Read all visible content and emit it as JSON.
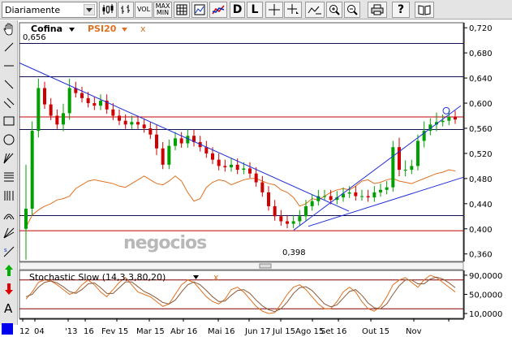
{
  "toolbar": {
    "period_value": "Diariamente",
    "vol_label": "VOL",
    "maxmin_label_1": "MAX",
    "maxmin_label_2": "MIN",
    "d_label": "D",
    "l_label": "L",
    "help_label": "?"
  },
  "legend": {
    "main_name": "Cofina",
    "compare_name": "PSI20",
    "close_mark": "x"
  },
  "watermark": "negocios",
  "annotations": {
    "high": "0,656",
    "low": "0,398"
  },
  "stoch_title": "Stochastic Slow (14,3,3,80,20)",
  "colors": {
    "price_up": "#00a000",
    "price_down": "#d00000",
    "psi20": "#e07020",
    "trend": "#2030d8",
    "stoch": "#e07020",
    "level_red": "#c00000",
    "level_navy": "#101050",
    "stoch_band": "#800000"
  },
  "chart_data": [
    {
      "type": "candlestick",
      "name": "Cofina",
      "yticks": [
        "0,720",
        "0,680",
        "0,640",
        "0,600",
        "0,560",
        "0,520",
        "0,480",
        "0,440",
        "0,400",
        "0,360"
      ],
      "ylim": [
        0.348,
        0.728
      ],
      "xticks": [
        "12",
        "04",
        "'13",
        "16",
        "Fev 15",
        "Mar 15",
        "Abr 16",
        "Mai 16",
        "Jun 17",
        "Jul 15",
        "Ago 15",
        "Set 16",
        "Out 15",
        "Nov"
      ],
      "hlines": [
        {
          "value": 0.695,
          "color": "navy"
        },
        {
          "value": 0.642,
          "color": "navy"
        },
        {
          "value": 0.578,
          "color": "red"
        },
        {
          "value": 0.558,
          "color": "navy"
        },
        {
          "value": 0.421,
          "color": "navy"
        },
        {
          "value": 0.397,
          "color": "red"
        }
      ],
      "close": [
        0.432,
        0.556,
        0.624,
        0.598,
        0.58,
        0.566,
        0.584,
        0.624,
        0.616,
        0.608,
        0.6,
        0.596,
        0.604,
        0.59,
        0.58,
        0.572,
        0.566,
        0.57,
        0.566,
        0.56,
        0.55,
        0.528,
        0.502,
        0.532,
        0.544,
        0.536,
        0.548,
        0.538,
        0.53,
        0.52,
        0.51,
        0.5,
        0.498,
        0.502,
        0.494,
        0.496,
        0.488,
        0.474,
        0.458,
        0.436,
        0.42,
        0.412,
        0.408,
        0.412,
        0.42,
        0.436,
        0.444,
        0.452,
        0.452,
        0.446,
        0.45,
        0.456,
        0.458,
        0.452,
        0.452,
        0.45,
        0.458,
        0.462,
        0.466,
        0.53,
        0.494,
        0.494,
        0.5,
        0.54,
        0.556,
        0.566,
        0.57,
        0.572,
        0.578,
        0.574
      ],
      "high_label": 0.656,
      "low_label": 0.398
    },
    {
      "type": "line",
      "name": "PSI20",
      "values": [
        0.402,
        0.422,
        0.43,
        0.436,
        0.44,
        0.446,
        0.448,
        0.452,
        0.464,
        0.47,
        0.476,
        0.478,
        0.476,
        0.474,
        0.472,
        0.468,
        0.466,
        0.472,
        0.478,
        0.484,
        0.478,
        0.472,
        0.47,
        0.476,
        0.484,
        0.476,
        0.458,
        0.444,
        0.448,
        0.466,
        0.474,
        0.478,
        0.476,
        0.47,
        0.474,
        0.478,
        0.48,
        0.48,
        0.476,
        0.472,
        0.47,
        0.462,
        0.458,
        0.45,
        0.436,
        0.44,
        0.448,
        0.446,
        0.452,
        0.458,
        0.462,
        0.464,
        0.462,
        0.468,
        0.476,
        0.478,
        0.472,
        0.474,
        0.478,
        0.48,
        0.476,
        0.474,
        0.472,
        0.476,
        0.48,
        0.484,
        0.488,
        0.49,
        0.494,
        0.492
      ]
    },
    {
      "type": "line",
      "name": "Stochastic Slow (14,3,3,80,20)",
      "yticks": [
        "90,0000",
        "50,0000",
        "10,0000"
      ],
      "ylim": [
        0,
        100
      ],
      "bands": [
        80,
        20
      ],
      "k": [
        40,
        55,
        75,
        80,
        78,
        70,
        60,
        50,
        55,
        70,
        80,
        70,
        55,
        45,
        60,
        75,
        85,
        70,
        55,
        50,
        45,
        35,
        25,
        30,
        50,
        70,
        80,
        75,
        60,
        45,
        35,
        30,
        40,
        60,
        65,
        55,
        40,
        25,
        15,
        10,
        12,
        30,
        50,
        65,
        70,
        60,
        45,
        30,
        20,
        20,
        35,
        55,
        65,
        55,
        35,
        20,
        15,
        25,
        45,
        70,
        80,
        85,
        75,
        65,
        80,
        90,
        85,
        75,
        65,
        55
      ],
      "d": [
        45,
        50,
        65,
        75,
        78,
        74,
        66,
        56,
        52,
        60,
        72,
        74,
        64,
        52,
        52,
        64,
        76,
        76,
        66,
        56,
        50,
        42,
        33,
        30,
        38,
        55,
        70,
        76,
        70,
        58,
        45,
        35,
        36,
        48,
        58,
        60,
        52,
        38,
        26,
        18,
        14,
        20,
        34,
        52,
        64,
        66,
        58,
        44,
        30,
        24,
        28,
        42,
        56,
        60,
        48,
        32,
        22,
        20,
        30,
        50,
        68,
        80,
        80,
        72,
        72,
        82,
        86,
        82,
        74,
        64
      ]
    }
  ]
}
